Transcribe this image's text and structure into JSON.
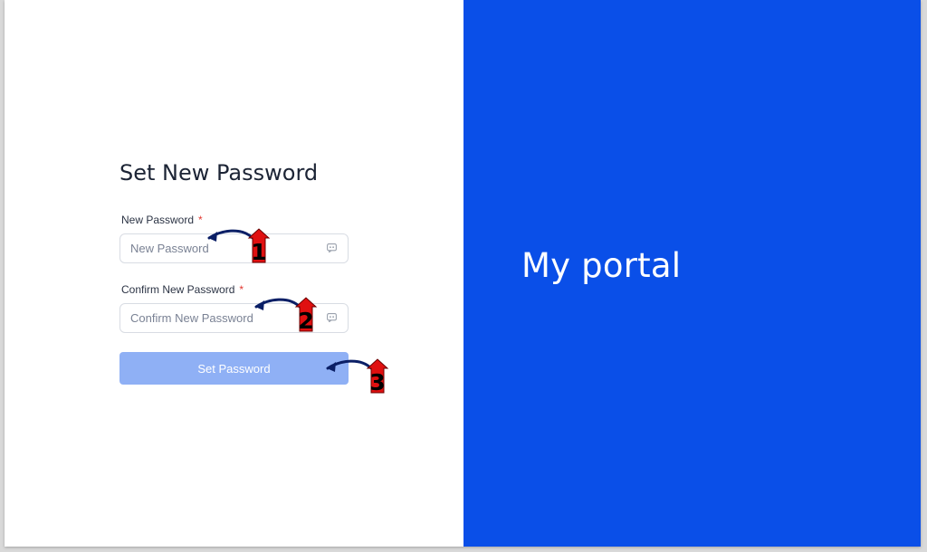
{
  "form": {
    "title": "Set New Password",
    "new_password": {
      "label": "New Password",
      "required_mark": "*",
      "placeholder": "New Password"
    },
    "confirm_password": {
      "label": "Confirm New Password",
      "required_mark": "*",
      "placeholder": "Confirm New Password"
    },
    "submit_label": "Set Password"
  },
  "brand": {
    "text": "My portal"
  },
  "annotations": [
    {
      "number": "1"
    },
    {
      "number": "2"
    },
    {
      "number": "3"
    }
  ],
  "colors": {
    "brand_panel": "#0a4fe8",
    "button_disabled": "#8fb0f5",
    "required": "#e2372f",
    "annotation_badge": "#e01010",
    "annotation_arrow": "#0b1f66"
  },
  "icons": {
    "password_toggle": "eye-toggle-icon",
    "annotation_arrow": "curved-arrow-icon"
  }
}
